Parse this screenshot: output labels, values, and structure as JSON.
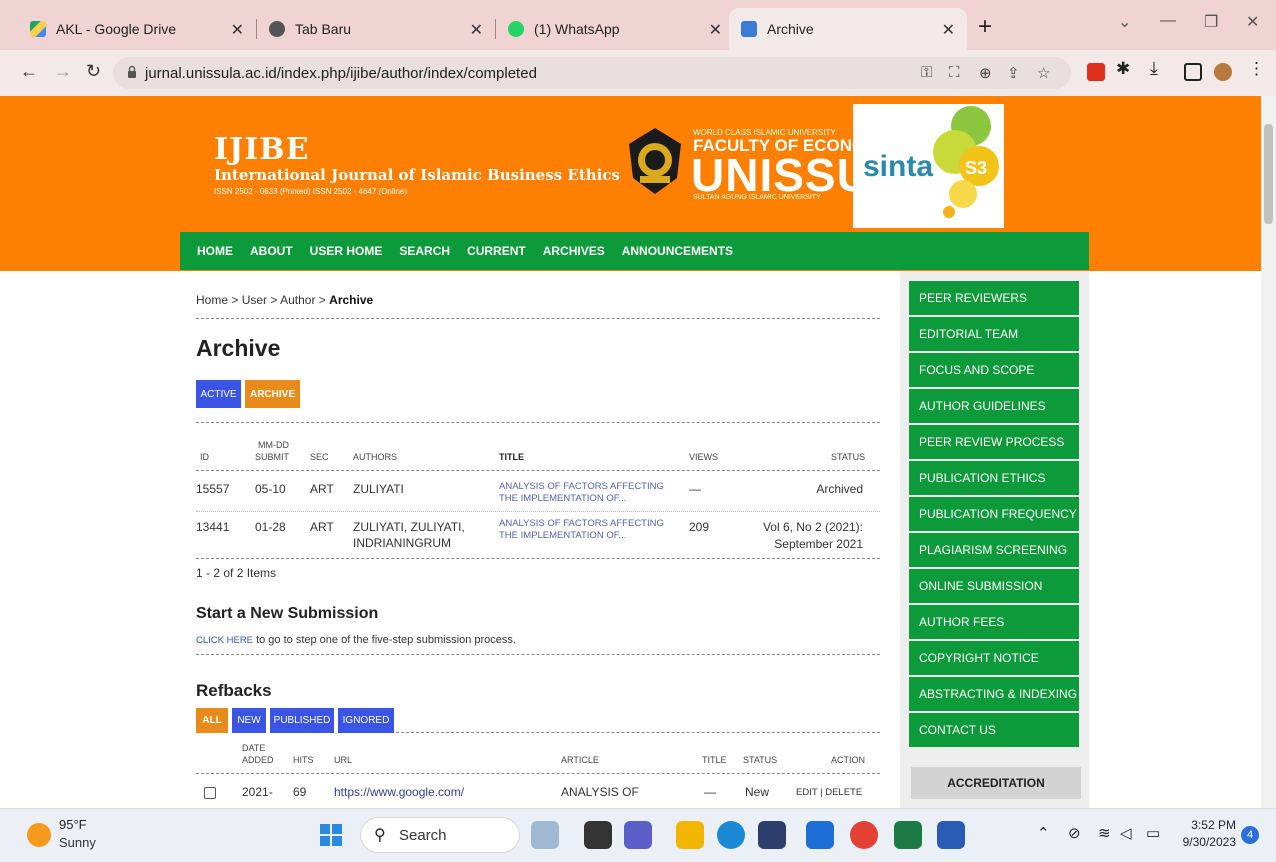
{
  "tabs": [
    {
      "label": "AKL - Google Drive",
      "icon": "google-drive-icon"
    },
    {
      "label": "Tab Baru",
      "icon": "chrome-icon"
    },
    {
      "label": "(1) WhatsApp",
      "icon": "whatsapp-icon"
    },
    {
      "label": "Archive",
      "icon": "site-icon",
      "active": true
    }
  ],
  "address_bar": {
    "url": "jurnal.unissula.ac.id/index.php/ijibe/author/index/completed"
  },
  "header": {
    "title": "IJIBE",
    "subtitle": "International Journal of Islamic Business Ethics",
    "issn": "ISSN 2502 - 0633 (Printed) ISSN 2502 - 4647 (Online)",
    "faculty_top": "WORLD CLASS ISLAMIC UNIVERSITY",
    "faculty": "FACULTY OF ECONOMICS",
    "university": "UNISSULA",
    "university_sub": "SULTAN AGUNG ISLAMIC UNIVERSITY",
    "sinta": "sinta",
    "sinta_level": "S3"
  },
  "nav": [
    "HOME",
    "ABOUT",
    "USER HOME",
    "SEARCH",
    "CURRENT",
    "ARCHIVES",
    "ANNOUNCEMENTS"
  ],
  "breadcrumb": {
    "home": "Home",
    "sep": ">",
    "user": "User",
    "author": "Author",
    "current": "Archive"
  },
  "page_title": "Archive",
  "filter_buttons": {
    "active": "ACTIVE",
    "archive": "ARCHIVE"
  },
  "submissions": {
    "headers": {
      "id": "ID",
      "mmdd": "MM-DD",
      "submit": "SUBMIT",
      "sec": "SEC",
      "authors": "AUTHORS",
      "title": "TITLE",
      "views": "VIEWS",
      "status": "STATUS"
    },
    "rows": [
      {
        "id": "15557",
        "date": "05-10",
        "sec": "ART",
        "authors_1": "ZULIYATI",
        "authors_2": "",
        "title_1": "ANALYSIS OF FACTORS AFFECTING",
        "title_2": "THE IMPLEMENTATION OF...",
        "views": "—",
        "status_1": "Archived",
        "status_2": ""
      },
      {
        "id": "13441",
        "date": "01-28",
        "sec": "ART",
        "authors_1": "ZULIYATI, ZULIYATI,",
        "authors_2": "INDRIANINGRUM",
        "title_1": "ANALYSIS OF FACTORS AFFECTING",
        "title_2": "THE IMPLEMENTATION OF...",
        "views": "209",
        "status_1": "Vol 6, No 2 (2021):",
        "status_2": "September 2021"
      }
    ],
    "count": "1 - 2 of 2 Items"
  },
  "new_submission": {
    "heading": "Start a New Submission",
    "link": "CLICK HERE",
    "text": " to go to step one of the five-step submission process."
  },
  "refbacks": {
    "heading": "Refbacks",
    "tabs": [
      "ALL",
      "NEW",
      "PUBLISHED",
      "IGNORED"
    ],
    "headers": {
      "date": "DATE",
      "added": "ADDED",
      "hits": "HITS",
      "url": "URL",
      "article": "ARTICLE",
      "title": "TITLE",
      "status": "STATUS",
      "action": "ACTION"
    },
    "row": {
      "date": "2021-",
      "hits": "69",
      "url": "https://www.google.com/",
      "article": "ANALYSIS OF",
      "title": "—",
      "status": "New",
      "edit": "EDIT",
      "sep": "|",
      "delete": "DELETE"
    }
  },
  "sidebar": {
    "items": [
      "PEER REVIEWERS",
      "EDITORIAL TEAM",
      "FOCUS AND SCOPE",
      "AUTHOR GUIDELINES",
      "PEER REVIEW PROCESS",
      "PUBLICATION ETHICS",
      "PUBLICATION FREQUENCY",
      "PLAGIARISM SCREENING",
      "ONLINE SUBMISSION",
      "AUTHOR FEES",
      "COPYRIGHT NOTICE",
      "ABSTRACTING & INDEXING",
      "CONTACT US"
    ],
    "accreditation": "ACCREDITATION"
  },
  "taskbar": {
    "temp": "95°F",
    "condition": "Sunny",
    "search": "Search",
    "time": "3:52 PM",
    "date": "9/30/2023",
    "notifications": "4"
  },
  "colors": {
    "orange": "#ff7f00",
    "green": "#0d9a3a",
    "blue": "#3a54e6",
    "tabstrip": "#f0d3d3"
  }
}
